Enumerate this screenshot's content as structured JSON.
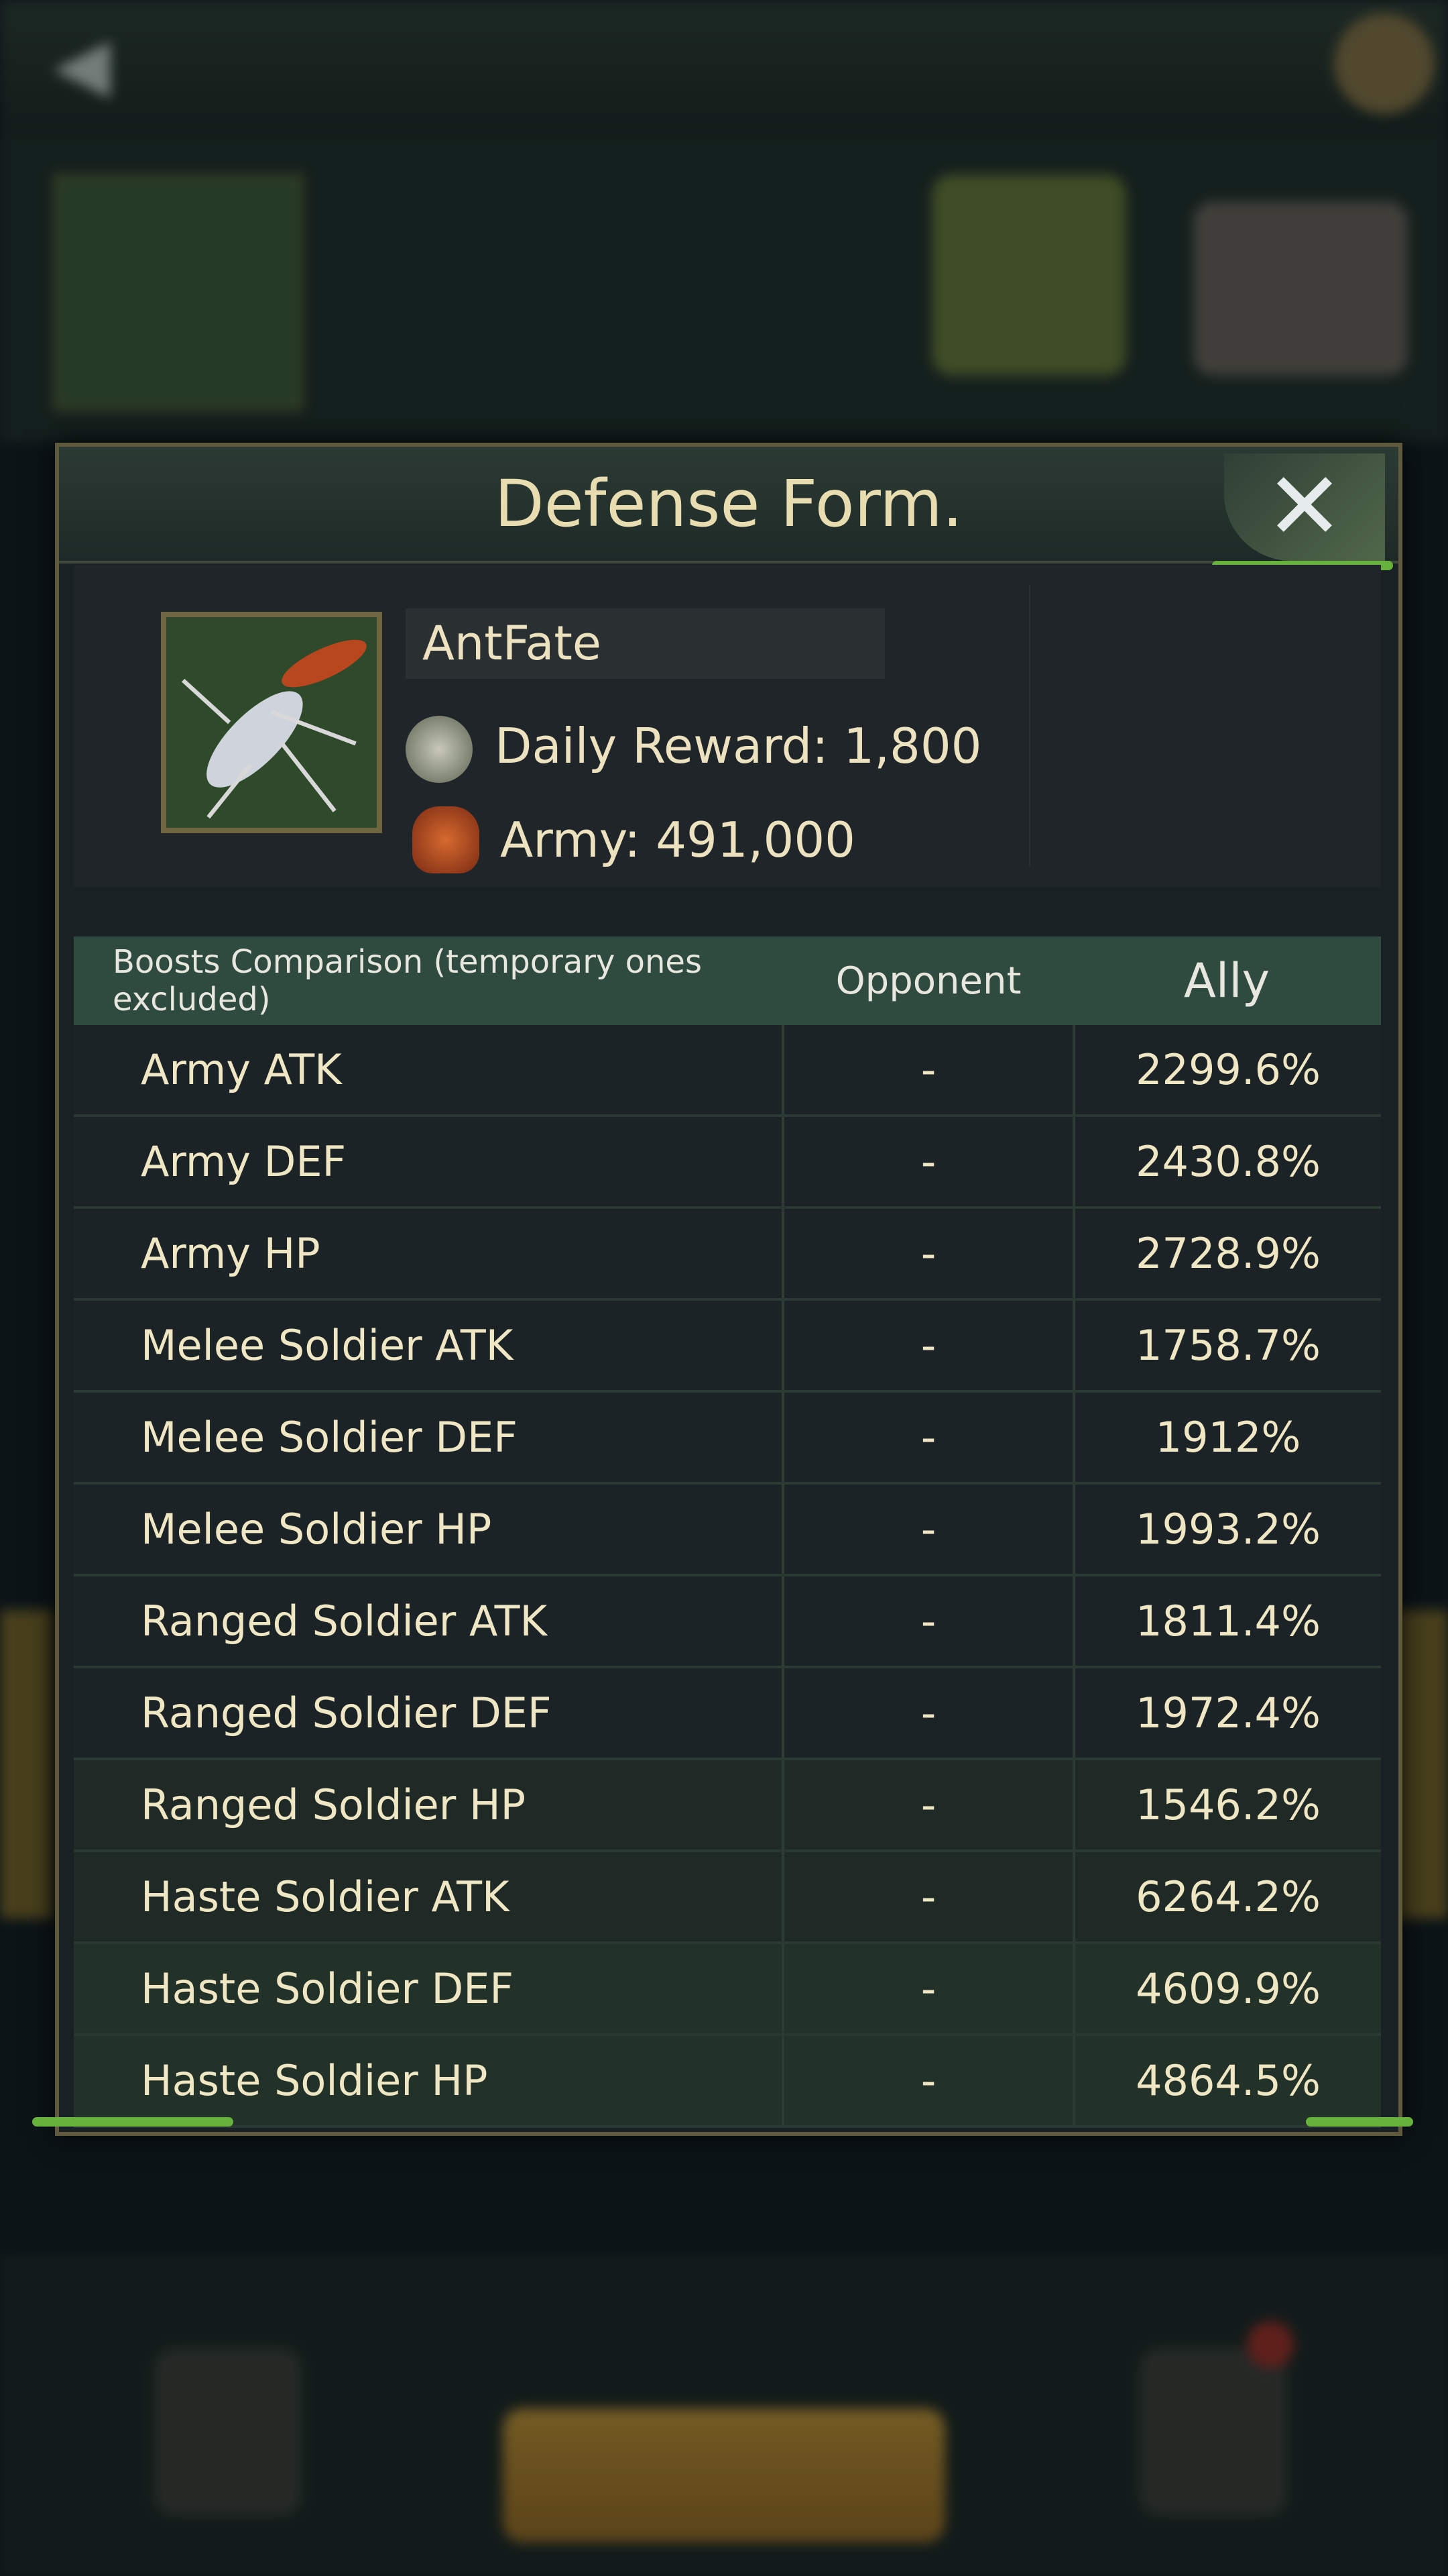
{
  "modal": {
    "title": "Defense Form.",
    "player": {
      "name": "AntFate",
      "daily_reward_label": "Daily Reward: 1,800",
      "army_label": "Army: 491,000"
    }
  },
  "table": {
    "headers": [
      "Boosts Comparison (temporary ones excluded)",
      "Opponent",
      "Ally"
    ],
    "rows": [
      {
        "boost": "Army ATK",
        "opponent": "-",
        "ally": "2299.6%"
      },
      {
        "boost": "Army DEF",
        "opponent": "-",
        "ally": "2430.8%"
      },
      {
        "boost": "Army HP",
        "opponent": "-",
        "ally": "2728.9%"
      },
      {
        "boost": "Melee Soldier ATK",
        "opponent": "-",
        "ally": "1758.7%"
      },
      {
        "boost": "Melee Soldier DEF",
        "opponent": "-",
        "ally": "1912%"
      },
      {
        "boost": "Melee Soldier HP",
        "opponent": "-",
        "ally": "1993.2%"
      },
      {
        "boost": "Ranged Soldier ATK",
        "opponent": "-",
        "ally": "1811.4%"
      },
      {
        "boost": "Ranged Soldier DEF",
        "opponent": "-",
        "ally": "1972.4%"
      },
      {
        "boost": "Ranged Soldier HP",
        "opponent": "-",
        "ally": "1546.2%"
      },
      {
        "boost": "Haste Soldier ATK",
        "opponent": "-",
        "ally": "6264.2%"
      },
      {
        "boost": "Haste Soldier DEF",
        "opponent": "-",
        "ally": "4609.9%"
      },
      {
        "boost": "Haste Soldier HP",
        "opponent": "-",
        "ally": "4864.5%"
      }
    ]
  },
  "icons": {
    "close": "close-icon",
    "reward": "reward-coin-icon",
    "army": "army-ant-icon",
    "avatar": "ant-avatar"
  },
  "colors": {
    "header_bg": "#2f4a3f",
    "text": "#efe6c4",
    "frame": "#5f5a3e"
  }
}
